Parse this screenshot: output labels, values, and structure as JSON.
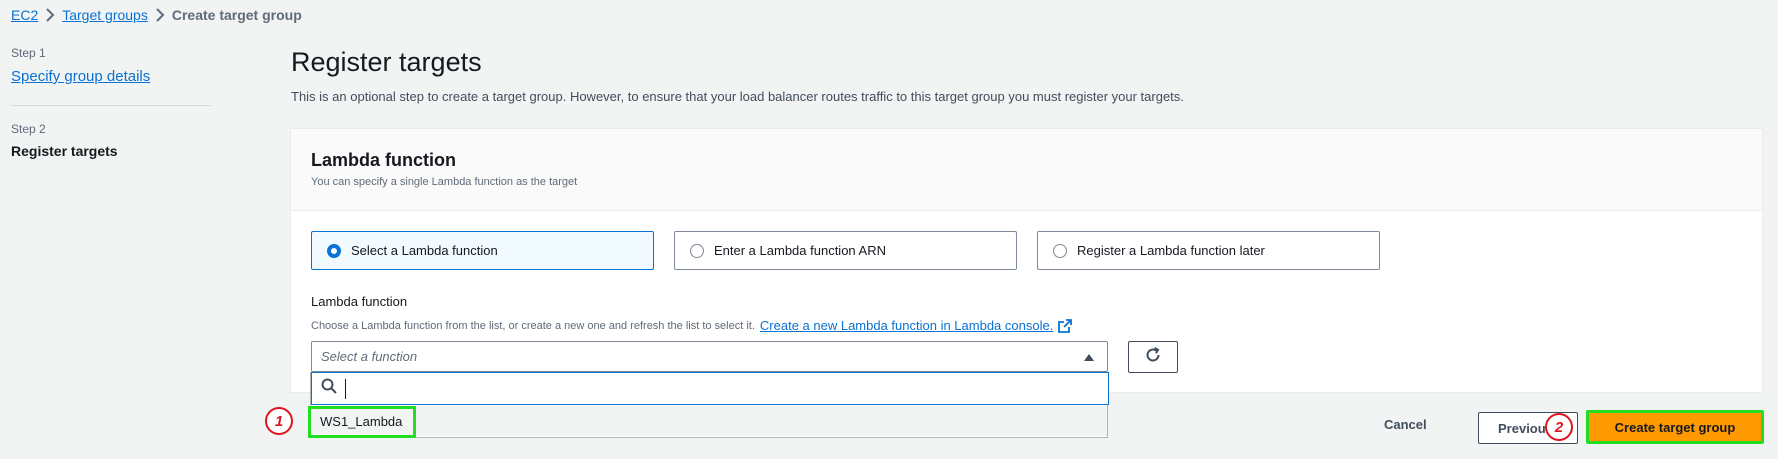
{
  "breadcrumb": {
    "items": [
      "EC2",
      "Target groups"
    ],
    "current": "Create target group"
  },
  "steps": {
    "step1_label": "Step 1",
    "step1_title": "Specify group details",
    "step2_label": "Step 2",
    "step2_title": "Register targets"
  },
  "main": {
    "title": "Register targets",
    "description": "This is an optional step to create a target group. However, to ensure that your load balancer routes traffic to this target group you must register your targets."
  },
  "lambda_panel": {
    "title": "Lambda function",
    "description": "You can specify a single Lambda function as the target",
    "options": [
      {
        "label": "Select a Lambda function",
        "selected": true
      },
      {
        "label": "Enter a Lambda function ARN",
        "selected": false
      },
      {
        "label": "Register a Lambda function later",
        "selected": false
      }
    ],
    "field_label": "Lambda function",
    "field_description": "Choose a Lambda function from the list, or create a new one and refresh the list to select it.",
    "create_link": "Create a new Lambda function in Lambda console.",
    "select_placeholder": "Select a function",
    "search_value": "",
    "dropdown_options": [
      "WS1_Lambda"
    ]
  },
  "actions": {
    "cancel": "Cancel",
    "previous": "Previous",
    "create": "Create target group"
  },
  "annotations": {
    "marker1": "1",
    "marker2": "2"
  },
  "colors": {
    "accent": "#0972d3",
    "primary_button": "#ff9900",
    "highlight": "#22dd22",
    "marker": "#e0141e"
  },
  "icons": [
    "chevron-right-icon",
    "external-link-icon",
    "caret-up-icon",
    "refresh-icon",
    "search-icon"
  ]
}
